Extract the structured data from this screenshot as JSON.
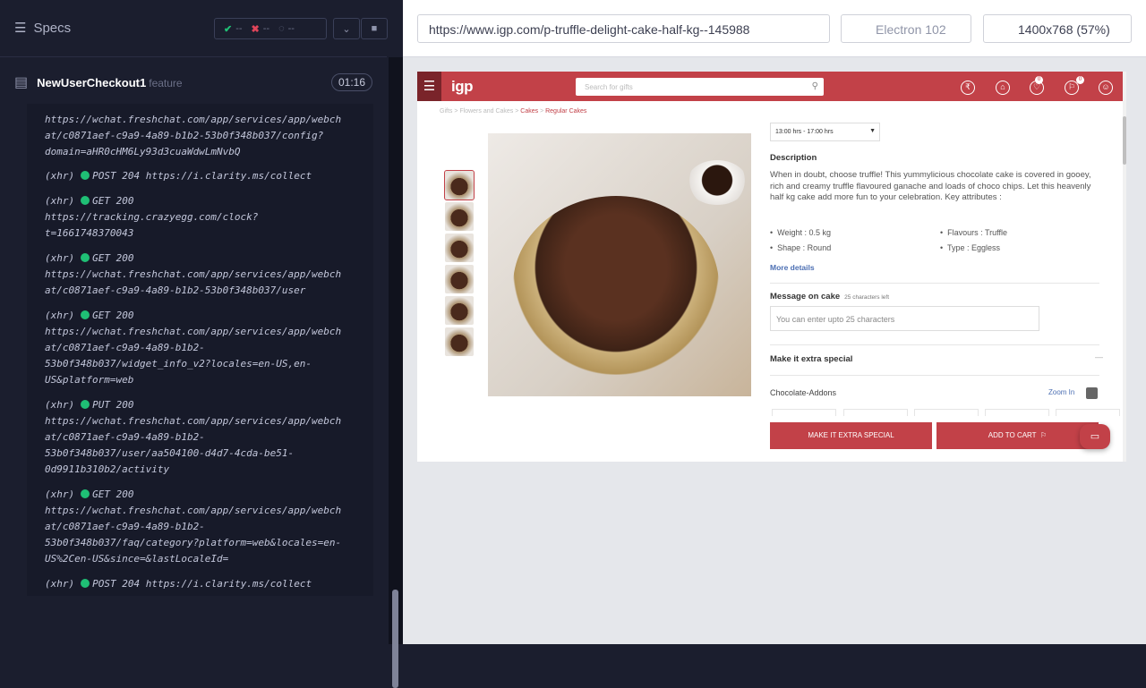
{
  "runner": {
    "specs_label": "Specs",
    "passed": "--",
    "failed": "--",
    "pending": "--",
    "spec_name": "NewUserCheckout1",
    "spec_type": "feature",
    "timer": "01:16",
    "logs": [
      "https://wchat.freshchat.com/app/services/app/webch\nat/c0871aef-c9a9-4a89-b1b2-53b0f348b037/config?\ndomain=aHR0cHM6Ly93d3cuaWdwLmNvbQ",
      "(xhr)  POST 204 https://i.clarity.ms/collect",
      "(xhr)  GET 200\nhttps://tracking.crazyegg.com/clock?\nt=1661748370043",
      "(xhr)  GET 200\nhttps://wchat.freshchat.com/app/services/app/webch\nat/c0871aef-c9a9-4a89-b1b2-53b0f348b037/user",
      "(xhr)  GET 200\nhttps://wchat.freshchat.com/app/services/app/webch\nat/c0871aef-c9a9-4a89-b1b2-\n53b0f348b037/widget_info_v2?locales=en-US,en-\nUS&platform=web",
      "(xhr)  PUT 200\nhttps://wchat.freshchat.com/app/services/app/webch\nat/c0871aef-c9a9-4a89-b1b2-\n53b0f348b037/user/aa504100-d4d7-4cda-be51-\n0d9911b310b2/activity",
      "(xhr)  GET 200\nhttps://wchat.freshchat.com/app/services/app/webch\nat/c0871aef-c9a9-4a89-b1b2-\n53b0f348b037/faq/category?platform=web&locales=en-\nUS%2Cen-US&since=&lastLocaleId=",
      "(xhr)  POST 204 https://i.clarity.ms/collect"
    ]
  },
  "browser": {
    "url": "https://www.igp.com/p-truffle-delight-cake-half-kg--145988",
    "name": "Electron 102",
    "viewport": "1400x768",
    "scale": "(57%)"
  },
  "site": {
    "logo": "igp",
    "search_placeholder": "Search for gifts",
    "wishlist_count": "0",
    "cart_count": "0",
    "breadcrumb": [
      "Gifts",
      "Flowers and Cakes",
      "Cakes",
      "Regular Cakes"
    ],
    "time_slot": "13:00 hrs - 17:00 hrs",
    "description_title": "Description",
    "description": "When in doubt, choose truffle! This yummylicious chocolate cake is covered in gooey, rich and creamy truffle flavoured ganache and loads of choco chips. Let this heavenly half kg cake add more fun to your celebration. Key attributes :",
    "attributes": [
      "Weight : 0.5 kg",
      "Flavours : Truffle",
      "Shape : Round",
      "Type : Eggless"
    ],
    "more_details": "More details",
    "message_title": "Message on cake",
    "message_hint": "25 characters left",
    "message_placeholder": "You can enter upto 25 characters",
    "extra_special_title": "Make it extra special",
    "addons_title": "Chocolate-Addons",
    "zoom_in": "Zoom In",
    "btn_extra": "MAKE IT EXTRA SPECIAL",
    "btn_cart": "ADD TO CART"
  }
}
